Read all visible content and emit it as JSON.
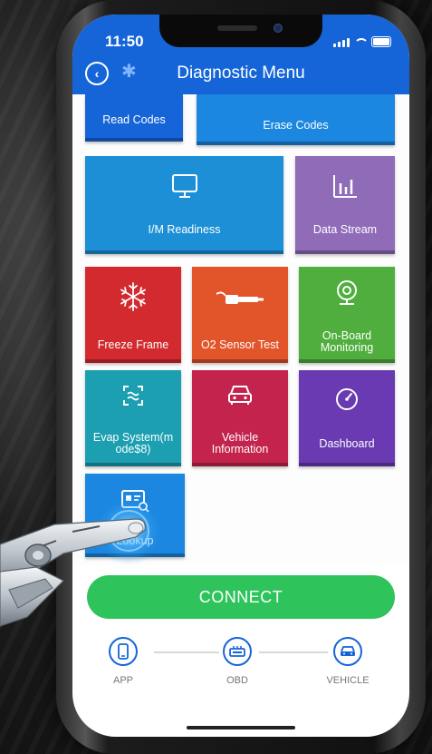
{
  "status": {
    "time": "11:50"
  },
  "header": {
    "title": "Diagnostic Menu"
  },
  "tiles": [
    {
      "label": "Read Codes",
      "icon": "",
      "color": "#1565d8"
    },
    {
      "label": "Erase Codes",
      "icon": "",
      "color": "#1c87e0"
    },
    {
      "label": "I/M Readiness",
      "icon": "monitor-icon",
      "color": "#1d8fd6"
    },
    {
      "label": "Data Stream",
      "icon": "bar-chart-icon",
      "color": "#8f6bb8"
    },
    {
      "label": "Freeze Frame",
      "icon": "snowflake-icon",
      "color": "#d32a2f"
    },
    {
      "label": "O2 Sensor Test",
      "icon": "sensor-probe-icon",
      "color": "#e2542a"
    },
    {
      "label": "On-Board\nMonitoring",
      "icon": "webcam-icon",
      "color": "#4fae3d"
    },
    {
      "label": "Evap System(m\node$8)",
      "icon": "evap-icon",
      "color": "#1b9fb1"
    },
    {
      "label": "Vehicle\nInformation",
      "icon": "car-icon",
      "color": "#c3234d"
    },
    {
      "label": "Dashboard",
      "icon": "gauge-icon",
      "color": "#6a3ab2"
    },
    {
      "label": "Lookup",
      "icon": "id-card-search-icon",
      "color": "#1b87e0"
    }
  ],
  "connect": {
    "label": "CONNECT",
    "color": "#2ec45b"
  },
  "steps": [
    {
      "label": "APP",
      "icon": "phone-icon"
    },
    {
      "label": "OBD",
      "icon": "obd-adapter-icon"
    },
    {
      "label": "VEHICLE",
      "icon": "car-icon"
    }
  ],
  "colors": {
    "brand": "#1565d8"
  }
}
